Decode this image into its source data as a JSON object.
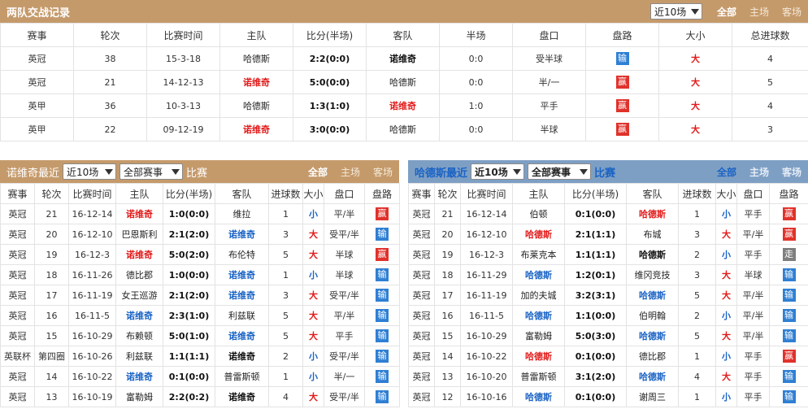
{
  "h2h": {
    "title": "两队交战记录",
    "range_select": "近10场",
    "tabs": [
      "全部",
      "主场",
      "客场"
    ],
    "columns": [
      "赛事",
      "轮次",
      "比赛时间",
      "主队",
      "比分(半场)",
      "客队",
      "半场",
      "盘口",
      "盘路",
      "大小",
      "总进球数"
    ],
    "rows": [
      {
        "league": "英冠",
        "round": "38",
        "date": "15-3-18",
        "home": "哈德斯",
        "home_style": "plain",
        "score": "2:2(0:0)",
        "away": "诺维奇",
        "away_style": "bold",
        "half": "0:0",
        "handicap": "受半球",
        "result": "输",
        "result_type": "lose",
        "ou": "大",
        "ou_type": "red",
        "goals": "4"
      },
      {
        "league": "英冠",
        "round": "21",
        "date": "14-12-13",
        "home": "诺维奇",
        "home_style": "red",
        "score": "5:0(0:0)",
        "away": "哈德斯",
        "away_style": "plain",
        "half": "0:0",
        "handicap": "半/一",
        "result": "赢",
        "result_type": "win",
        "ou": "大",
        "ou_type": "red",
        "goals": "5"
      },
      {
        "league": "英甲",
        "round": "36",
        "date": "10-3-13",
        "home": "哈德斯",
        "home_style": "plain",
        "score": "1:3(1:0)",
        "away": "诺维奇",
        "away_style": "red",
        "half": "1:0",
        "handicap": "平手",
        "result": "赢",
        "result_type": "win",
        "ou": "大",
        "ou_type": "red",
        "goals": "4"
      },
      {
        "league": "英甲",
        "round": "22",
        "date": "09-12-19",
        "home": "诺维奇",
        "home_style": "red",
        "score": "3:0(0:0)",
        "away": "哈德斯",
        "away_style": "plain",
        "half": "0:0",
        "handicap": "半球",
        "result": "赢",
        "result_type": "win",
        "ou": "大",
        "ou_type": "red",
        "goals": "3"
      }
    ]
  },
  "left": {
    "title": "诺维奇最近",
    "range_select": "近10场",
    "comp_select": "全部赛事",
    "suffix": "比赛",
    "tabs": [
      "全部",
      "主场",
      "客场"
    ],
    "columns": [
      "赛事",
      "轮次",
      "比赛时间",
      "主队",
      "比分(半场)",
      "客队",
      "进球数",
      "大小",
      "盘口",
      "盘路"
    ],
    "rows": [
      {
        "league": "英冠",
        "round": "21",
        "date": "16-12-14",
        "home": "诺维奇",
        "home_style": "red",
        "score": "1:0(0:0)",
        "away": "维拉",
        "away_style": "plain",
        "goals": "1",
        "ou": "小",
        "ou_type": "blue",
        "handicap": "平/半",
        "result": "赢",
        "result_type": "win"
      },
      {
        "league": "英冠",
        "round": "20",
        "date": "16-12-10",
        "home": "巴恩斯利",
        "home_style": "plain",
        "score": "2:1(2:0)",
        "away": "诺维奇",
        "away_style": "blue",
        "goals": "3",
        "ou": "大",
        "ou_type": "red",
        "handicap": "受平/半",
        "result": "输",
        "result_type": "lose"
      },
      {
        "league": "英冠",
        "round": "19",
        "date": "16-12-3",
        "home": "诺维奇",
        "home_style": "red",
        "score": "5:0(2:0)",
        "away": "布伦特",
        "away_style": "plain",
        "goals": "5",
        "ou": "大",
        "ou_type": "red",
        "handicap": "半球",
        "result": "赢",
        "result_type": "win"
      },
      {
        "league": "英冠",
        "round": "18",
        "date": "16-11-26",
        "home": "德比郡",
        "home_style": "plain",
        "score": "1:0(0:0)",
        "away": "诺维奇",
        "away_style": "blue",
        "goals": "1",
        "ou": "小",
        "ou_type": "blue",
        "handicap": "半球",
        "result": "输",
        "result_type": "lose"
      },
      {
        "league": "英冠",
        "round": "17",
        "date": "16-11-19",
        "home": "女王巡游",
        "home_style": "plain",
        "score": "2:1(2:0)",
        "away": "诺维奇",
        "away_style": "blue",
        "goals": "3",
        "ou": "大",
        "ou_type": "red",
        "handicap": "受平/半",
        "result": "输",
        "result_type": "lose"
      },
      {
        "league": "英冠",
        "round": "16",
        "date": "16-11-5",
        "home": "诺维奇",
        "home_style": "blue",
        "score": "2:3(1:0)",
        "away": "利兹联",
        "away_style": "plain",
        "goals": "5",
        "ou": "大",
        "ou_type": "red",
        "handicap": "平/半",
        "result": "输",
        "result_type": "lose"
      },
      {
        "league": "英冠",
        "round": "15",
        "date": "16-10-29",
        "home": "布赖顿",
        "home_style": "plain",
        "score": "5:0(1:0)",
        "away": "诺维奇",
        "away_style": "blue",
        "goals": "5",
        "ou": "大",
        "ou_type": "red",
        "handicap": "平手",
        "result": "输",
        "result_type": "lose"
      },
      {
        "league": "英联杯",
        "round": "第四圈",
        "date": "16-10-26",
        "home": "利兹联",
        "home_style": "plain",
        "score": "1:1(1:1)",
        "away": "诺维奇",
        "away_style": "bold",
        "goals": "2",
        "ou": "小",
        "ou_type": "blue",
        "handicap": "受平/半",
        "result": "输",
        "result_type": "lose"
      },
      {
        "league": "英冠",
        "round": "14",
        "date": "16-10-22",
        "home": "诺维奇",
        "home_style": "blue",
        "score": "0:1(0:0)",
        "away": "普雷斯顿",
        "away_style": "plain",
        "goals": "1",
        "ou": "小",
        "ou_type": "blue",
        "handicap": "半/一",
        "result": "输",
        "result_type": "lose"
      },
      {
        "league": "英冠",
        "round": "13",
        "date": "16-10-19",
        "home": "富勒姆",
        "home_style": "plain",
        "score": "2:2(0:2)",
        "away": "诺维奇",
        "away_style": "bold",
        "goals": "4",
        "ou": "大",
        "ou_type": "red",
        "handicap": "受平/半",
        "result": "输",
        "result_type": "lose"
      }
    ]
  },
  "right": {
    "title": "哈德斯最近",
    "range_select": "近10场",
    "comp_select": "全部赛事",
    "suffix": "比赛",
    "tabs": [
      "全部",
      "主场",
      "客场"
    ],
    "columns": [
      "赛事",
      "轮次",
      "比赛时间",
      "主队",
      "比分(半场)",
      "客队",
      "进球数",
      "大小",
      "盘口",
      "盘路"
    ],
    "rows": [
      {
        "league": "英冠",
        "round": "21",
        "date": "16-12-14",
        "home": "伯顿",
        "home_style": "plain",
        "score": "0:1(0:0)",
        "away": "哈德斯",
        "away_style": "red",
        "goals": "1",
        "ou": "小",
        "ou_type": "blue",
        "handicap": "平手",
        "result": "赢",
        "result_type": "win"
      },
      {
        "league": "英冠",
        "round": "20",
        "date": "16-12-10",
        "home": "哈德斯",
        "home_style": "red",
        "score": "2:1(1:1)",
        "away": "布城",
        "away_style": "plain",
        "goals": "3",
        "ou": "大",
        "ou_type": "red",
        "handicap": "平/半",
        "result": "赢",
        "result_type": "win"
      },
      {
        "league": "英冠",
        "round": "19",
        "date": "16-12-3",
        "home": "布莱克本",
        "home_style": "plain",
        "score": "1:1(1:1)",
        "away": "哈德斯",
        "away_style": "bold",
        "goals": "2",
        "ou": "小",
        "ou_type": "blue",
        "handicap": "平手",
        "result": "走",
        "result_type": "draw"
      },
      {
        "league": "英冠",
        "round": "18",
        "date": "16-11-29",
        "home": "哈德斯",
        "home_style": "blue",
        "score": "1:2(0:1)",
        "away": "维冈竞技",
        "away_style": "plain",
        "goals": "3",
        "ou": "大",
        "ou_type": "red",
        "handicap": "半球",
        "result": "输",
        "result_type": "lose"
      },
      {
        "league": "英冠",
        "round": "17",
        "date": "16-11-19",
        "home": "加的夫城",
        "home_style": "plain",
        "score": "3:2(3:1)",
        "away": "哈德斯",
        "away_style": "blue",
        "goals": "5",
        "ou": "大",
        "ou_type": "red",
        "handicap": "平/半",
        "result": "输",
        "result_type": "lose"
      },
      {
        "league": "英冠",
        "round": "16",
        "date": "16-11-5",
        "home": "哈德斯",
        "home_style": "blue",
        "score": "1:1(0:0)",
        "away": "伯明翰",
        "away_style": "plain",
        "goals": "2",
        "ou": "小",
        "ou_type": "blue",
        "handicap": "平/半",
        "result": "输",
        "result_type": "lose"
      },
      {
        "league": "英冠",
        "round": "15",
        "date": "16-10-29",
        "home": "富勒姆",
        "home_style": "plain",
        "score": "5:0(3:0)",
        "away": "哈德斯",
        "away_style": "blue",
        "goals": "5",
        "ou": "大",
        "ou_type": "red",
        "handicap": "平/半",
        "result": "输",
        "result_type": "lose"
      },
      {
        "league": "英冠",
        "round": "14",
        "date": "16-10-22",
        "home": "哈德斯",
        "home_style": "red",
        "score": "0:1(0:0)",
        "away": "德比郡",
        "away_style": "plain",
        "goals": "1",
        "ou": "小",
        "ou_type": "blue",
        "handicap": "平手",
        "result": "赢",
        "result_type": "win"
      },
      {
        "league": "英冠",
        "round": "13",
        "date": "16-10-20",
        "home": "普雷斯顿",
        "home_style": "plain",
        "score": "3:1(2:0)",
        "away": "哈德斯",
        "away_style": "blue",
        "goals": "4",
        "ou": "大",
        "ou_type": "red",
        "handicap": "平手",
        "result": "输",
        "result_type": "lose"
      },
      {
        "league": "英冠",
        "round": "12",
        "date": "16-10-16",
        "home": "哈德斯",
        "home_style": "blue",
        "score": "0:1(0:0)",
        "away": "谢周三",
        "away_style": "plain",
        "goals": "1",
        "ou": "小",
        "ou_type": "blue",
        "handicap": "平手",
        "result": "输",
        "result_type": "lose"
      }
    ]
  },
  "colors": {
    "win": "#e0322b",
    "lose": "#2f7fd3",
    "draw": "#7e7e7e",
    "header_brown": "#c59a6b",
    "header_blue": "#7e9fc4"
  }
}
